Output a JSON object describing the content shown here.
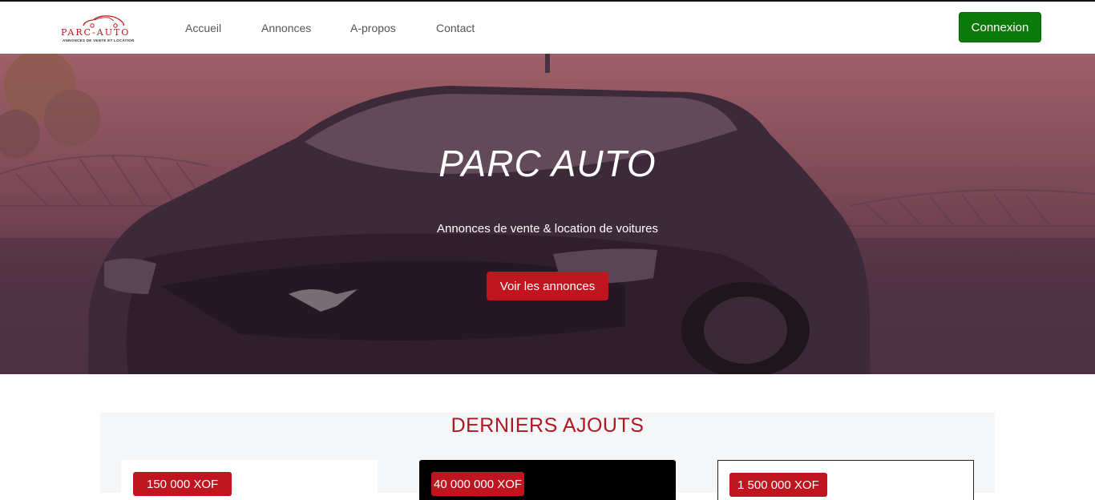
{
  "brand": {
    "name": "PARC-AUTO",
    "tagline": "ANNONCES DE VENTE ET LOCATION",
    "logo_color": "#c0141e"
  },
  "nav": {
    "links": [
      "Accueil",
      "Annonces",
      "A-propos",
      "Contact"
    ],
    "login_label": "Connexion",
    "login_color": "#0b7a0b"
  },
  "hero": {
    "title": "PARC AUTO",
    "subtitle": "Annonces de vente & location de voitures",
    "cta_label": "Voir les annonces",
    "cta_color": "#c0141e"
  },
  "latest": {
    "title": "DERNIERS AJOUTS",
    "cards": [
      {
        "price": "150 000 XOF"
      },
      {
        "price": "40 000 000 XOF"
      },
      {
        "price": "1 500 000 XOF"
      }
    ]
  }
}
